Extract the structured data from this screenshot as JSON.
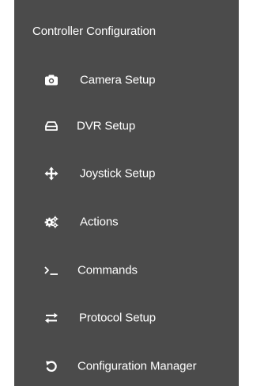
{
  "panel": {
    "title": "Controller Configuration",
    "background": "#4b4b4b",
    "text_color": "#ffffff"
  },
  "menu": {
    "items": [
      {
        "label": "Camera Setup",
        "icon": "camera-icon"
      },
      {
        "label": "DVR Setup",
        "icon": "dvr-icon"
      },
      {
        "label": "Joystick Setup",
        "icon": "move-arrows-icon"
      },
      {
        "label": "Actions",
        "icon": "gears-icon"
      },
      {
        "label": "Commands",
        "icon": "terminal-icon"
      },
      {
        "label": "Protocol Setup",
        "icon": "swap-arrows-icon"
      },
      {
        "label": "Configuration Manager",
        "icon": "undo-icon"
      }
    ]
  }
}
